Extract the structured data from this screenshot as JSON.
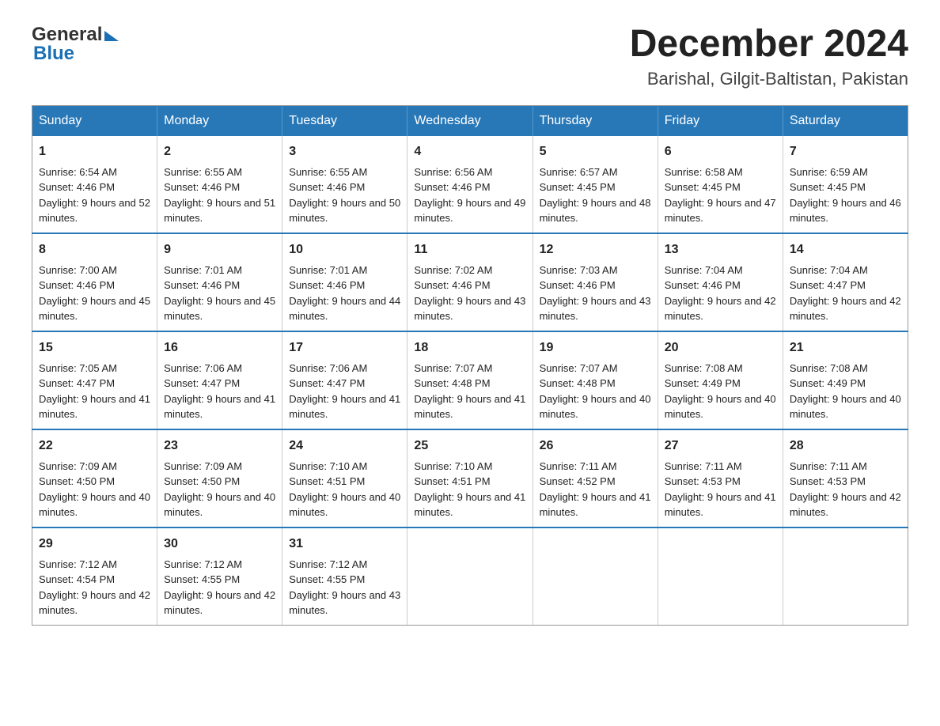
{
  "header": {
    "month_year": "December 2024",
    "location": "Barishal, Gilgit-Baltistan, Pakistan",
    "logo_general": "General",
    "logo_blue": "Blue"
  },
  "weekdays": [
    "Sunday",
    "Monday",
    "Tuesday",
    "Wednesday",
    "Thursday",
    "Friday",
    "Saturday"
  ],
  "weeks": [
    [
      {
        "day": 1,
        "sunrise": "6:54 AM",
        "sunset": "4:46 PM",
        "daylight": "9 hours and 52 minutes."
      },
      {
        "day": 2,
        "sunrise": "6:55 AM",
        "sunset": "4:46 PM",
        "daylight": "9 hours and 51 minutes."
      },
      {
        "day": 3,
        "sunrise": "6:55 AM",
        "sunset": "4:46 PM",
        "daylight": "9 hours and 50 minutes."
      },
      {
        "day": 4,
        "sunrise": "6:56 AM",
        "sunset": "4:46 PM",
        "daylight": "9 hours and 49 minutes."
      },
      {
        "day": 5,
        "sunrise": "6:57 AM",
        "sunset": "4:45 PM",
        "daylight": "9 hours and 48 minutes."
      },
      {
        "day": 6,
        "sunrise": "6:58 AM",
        "sunset": "4:45 PM",
        "daylight": "9 hours and 47 minutes."
      },
      {
        "day": 7,
        "sunrise": "6:59 AM",
        "sunset": "4:45 PM",
        "daylight": "9 hours and 46 minutes."
      }
    ],
    [
      {
        "day": 8,
        "sunrise": "7:00 AM",
        "sunset": "4:46 PM",
        "daylight": "9 hours and 45 minutes."
      },
      {
        "day": 9,
        "sunrise": "7:01 AM",
        "sunset": "4:46 PM",
        "daylight": "9 hours and 45 minutes."
      },
      {
        "day": 10,
        "sunrise": "7:01 AM",
        "sunset": "4:46 PM",
        "daylight": "9 hours and 44 minutes."
      },
      {
        "day": 11,
        "sunrise": "7:02 AM",
        "sunset": "4:46 PM",
        "daylight": "9 hours and 43 minutes."
      },
      {
        "day": 12,
        "sunrise": "7:03 AM",
        "sunset": "4:46 PM",
        "daylight": "9 hours and 43 minutes."
      },
      {
        "day": 13,
        "sunrise": "7:04 AM",
        "sunset": "4:46 PM",
        "daylight": "9 hours and 42 minutes."
      },
      {
        "day": 14,
        "sunrise": "7:04 AM",
        "sunset": "4:47 PM",
        "daylight": "9 hours and 42 minutes."
      }
    ],
    [
      {
        "day": 15,
        "sunrise": "7:05 AM",
        "sunset": "4:47 PM",
        "daylight": "9 hours and 41 minutes."
      },
      {
        "day": 16,
        "sunrise": "7:06 AM",
        "sunset": "4:47 PM",
        "daylight": "9 hours and 41 minutes."
      },
      {
        "day": 17,
        "sunrise": "7:06 AM",
        "sunset": "4:47 PM",
        "daylight": "9 hours and 41 minutes."
      },
      {
        "day": 18,
        "sunrise": "7:07 AM",
        "sunset": "4:48 PM",
        "daylight": "9 hours and 41 minutes."
      },
      {
        "day": 19,
        "sunrise": "7:07 AM",
        "sunset": "4:48 PM",
        "daylight": "9 hours and 40 minutes."
      },
      {
        "day": 20,
        "sunrise": "7:08 AM",
        "sunset": "4:49 PM",
        "daylight": "9 hours and 40 minutes."
      },
      {
        "day": 21,
        "sunrise": "7:08 AM",
        "sunset": "4:49 PM",
        "daylight": "9 hours and 40 minutes."
      }
    ],
    [
      {
        "day": 22,
        "sunrise": "7:09 AM",
        "sunset": "4:50 PM",
        "daylight": "9 hours and 40 minutes."
      },
      {
        "day": 23,
        "sunrise": "7:09 AM",
        "sunset": "4:50 PM",
        "daylight": "9 hours and 40 minutes."
      },
      {
        "day": 24,
        "sunrise": "7:10 AM",
        "sunset": "4:51 PM",
        "daylight": "9 hours and 40 minutes."
      },
      {
        "day": 25,
        "sunrise": "7:10 AM",
        "sunset": "4:51 PM",
        "daylight": "9 hours and 41 minutes."
      },
      {
        "day": 26,
        "sunrise": "7:11 AM",
        "sunset": "4:52 PM",
        "daylight": "9 hours and 41 minutes."
      },
      {
        "day": 27,
        "sunrise": "7:11 AM",
        "sunset": "4:53 PM",
        "daylight": "9 hours and 41 minutes."
      },
      {
        "day": 28,
        "sunrise": "7:11 AM",
        "sunset": "4:53 PM",
        "daylight": "9 hours and 42 minutes."
      }
    ],
    [
      {
        "day": 29,
        "sunrise": "7:12 AM",
        "sunset": "4:54 PM",
        "daylight": "9 hours and 42 minutes."
      },
      {
        "day": 30,
        "sunrise": "7:12 AM",
        "sunset": "4:55 PM",
        "daylight": "9 hours and 42 minutes."
      },
      {
        "day": 31,
        "sunrise": "7:12 AM",
        "sunset": "4:55 PM",
        "daylight": "9 hours and 43 minutes."
      },
      null,
      null,
      null,
      null
    ]
  ],
  "labels": {
    "sunrise_prefix": "Sunrise: ",
    "sunset_prefix": "Sunset: ",
    "daylight_prefix": "Daylight: "
  }
}
